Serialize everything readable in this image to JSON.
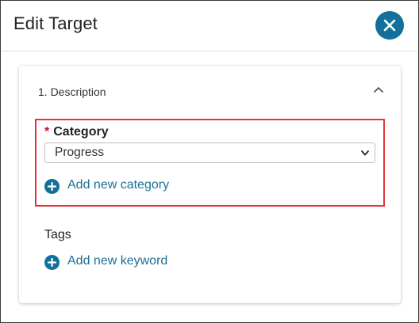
{
  "dialog": {
    "title": "Edit Target",
    "close_icon": "close-icon"
  },
  "section": {
    "title": "1. Description",
    "collapse_icon": "chevron-up-icon"
  },
  "category": {
    "required_marker": "*",
    "label": "Category",
    "selected_value": "Progress",
    "add_label": "Add new category"
  },
  "tags": {
    "label": "Tags",
    "add_label": "Add new keyword"
  },
  "colors": {
    "accent": "#12709a",
    "link": "#1e6f97",
    "highlight_border": "#e2363c",
    "required": "#c8102e"
  }
}
